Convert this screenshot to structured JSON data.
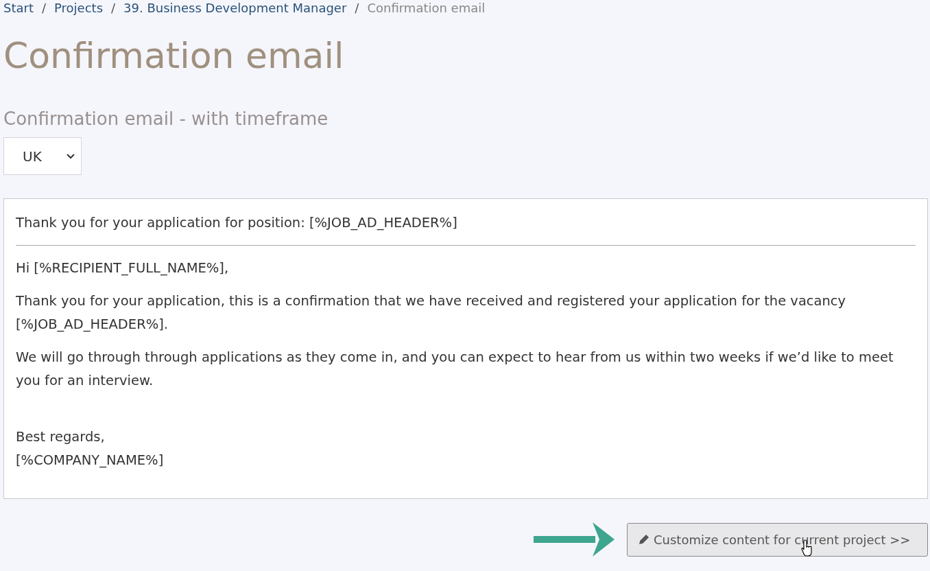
{
  "breadcrumb": [
    {
      "label": "Start",
      "kind": "link"
    },
    {
      "label": "Projects",
      "kind": "link"
    },
    {
      "label": "39. Business Development Manager",
      "kind": "link"
    },
    {
      "label": "Confirmation email",
      "kind": "current"
    }
  ],
  "breadcrumb_separator": "/",
  "title": "Confirmation email",
  "template_name": "Confirmation email - with timeframe",
  "language_select": {
    "value": "UK"
  },
  "email": {
    "subject": "Thank you for your application for position: [%JOB_AD_HEADER%]",
    "paragraphs": [
      {
        "kind": "text",
        "lines": [
          "Hi [%RECIPIENT_FULL_NAME%],"
        ]
      },
      {
        "kind": "text",
        "lines": [
          "Thank you for your application, this is a confirmation that we have received and registered your application for the vacancy [%JOB_AD_HEADER%]."
        ]
      },
      {
        "kind": "text",
        "lines": [
          "We will go through through applications as they come in, and you can expect to hear from us within two weeks if we’d like to meet you for an interview."
        ]
      },
      {
        "kind": "signature",
        "lines": [
          "Best regards,",
          "[%COMPANY_NAME%]"
        ]
      }
    ]
  },
  "customize_button": {
    "label": "Customize content for current project >>"
  }
}
